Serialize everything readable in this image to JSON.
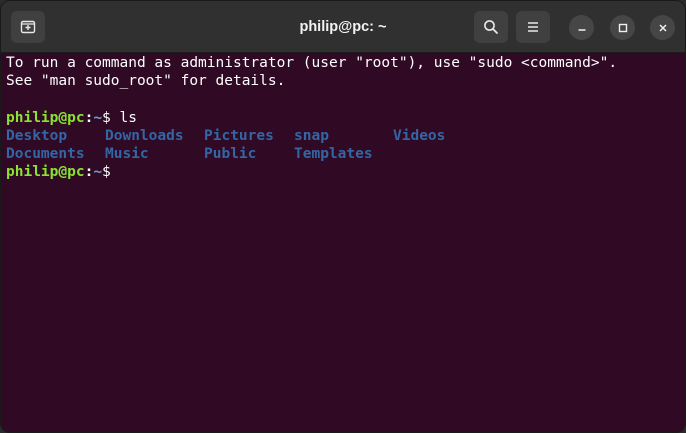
{
  "window": {
    "title": "philip@pc: ~"
  },
  "titlebar": {
    "icons": {
      "new_tab": "new-tab-icon",
      "search": "search-icon",
      "menu": "hamburger-menu-icon",
      "minimize": "minimize-icon",
      "maximize": "maximize-icon",
      "close": "close-icon"
    }
  },
  "colors": {
    "terminal_bg": "#300a24",
    "prompt_user": "#8ae234",
    "prompt_path": "#729fcf",
    "directory": "#3465a4",
    "titlebar_bg": "#303030"
  },
  "terminal": {
    "motd": [
      "To run a command as administrator (user \"root\"), use \"sudo <command>\".",
      "See \"man sudo_root\" for details."
    ],
    "prompt": {
      "user_host": "philip@pc",
      "separator": ":",
      "path": "~",
      "sign": "$"
    },
    "command": " ls",
    "ls_output": [
      [
        "Desktop",
        "Downloads",
        "Pictures",
        "snap",
        "Videos"
      ],
      [
        "Documents",
        "Music",
        "Public",
        "Templates"
      ]
    ]
  }
}
